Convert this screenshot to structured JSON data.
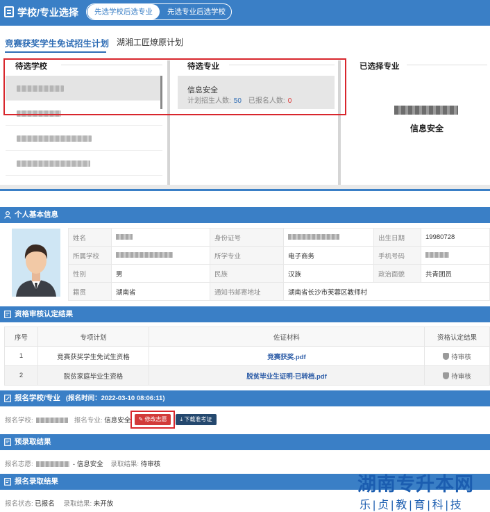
{
  "topbar": {
    "title": "学校/专业选择",
    "toggle": [
      "先选学校后选专业",
      "先选专业后选学校"
    ]
  },
  "plan_tabs": [
    "竞赛获奖学生免试招生计划",
    "湖湘工匠燎原计划"
  ],
  "selection": {
    "schools_title": "待选学校",
    "majors_title": "待选专业",
    "chosen_title": "已选择专业",
    "major": {
      "name": "信息安全",
      "plan_label": "计划招生人数:",
      "plan_value": "50",
      "applied_label": "已报名人数:",
      "applied_value": "0"
    },
    "chosen_major": "信息安全"
  },
  "personal": {
    "header": "个人基本信息",
    "rows": [
      [
        "姓名",
        "",
        "身份证号",
        "",
        "出生日期",
        "19980728"
      ],
      [
        "所属学校",
        "",
        "所学专业",
        "电子商务",
        "手机号码",
        ""
      ],
      [
        "性别",
        "男",
        "民族",
        "汉族",
        "政治面貌",
        "共青团员"
      ],
      [
        "籍贯",
        "湖南省",
        "通知书邮寄地址",
        "湖南省长沙市芙蓉区教师村",
        "",
        ""
      ]
    ]
  },
  "qualification": {
    "header": "资格审核认定结果",
    "columns": [
      "序号",
      "专项计划",
      "佐证材料",
      "资格认定结果"
    ],
    "rows": [
      [
        "1",
        "竞赛获奖学生免试生资格",
        "竞赛获奖.pdf",
        "待审核"
      ],
      [
        "2",
        "脱贫家庭毕业生资格",
        "脱贫毕业生证明-已转档.pdf",
        "待审核"
      ]
    ]
  },
  "registration": {
    "header": "报名学校/专业",
    "time": "(报名时间：2022-03-10 08:06:11)",
    "school_label": "报名学校:",
    "major_label": "报名专业:",
    "major_value": "信息安全",
    "edit_button": "修改志愿",
    "download_button": "下载准考证"
  },
  "pre_admission": {
    "header": "预录取结果",
    "wish_label": "报名志愿:",
    "wish_value": "- 信息安全",
    "result_label": "录取结果:",
    "result_value": "待审核"
  },
  "final_admission": {
    "header": "报名录取结果",
    "status_label": "报名状态:",
    "status_value": "已报名",
    "result_label": "录取结果:",
    "result_value": "未开放"
  },
  "watermark": {
    "line1": "湖南专升本网",
    "line2": "乐|贞|教|育|科|技"
  },
  "colors": {
    "primary": "#3a7fc6",
    "highlight_red": "#d8262c",
    "link_blue": "#2f5ea8"
  }
}
